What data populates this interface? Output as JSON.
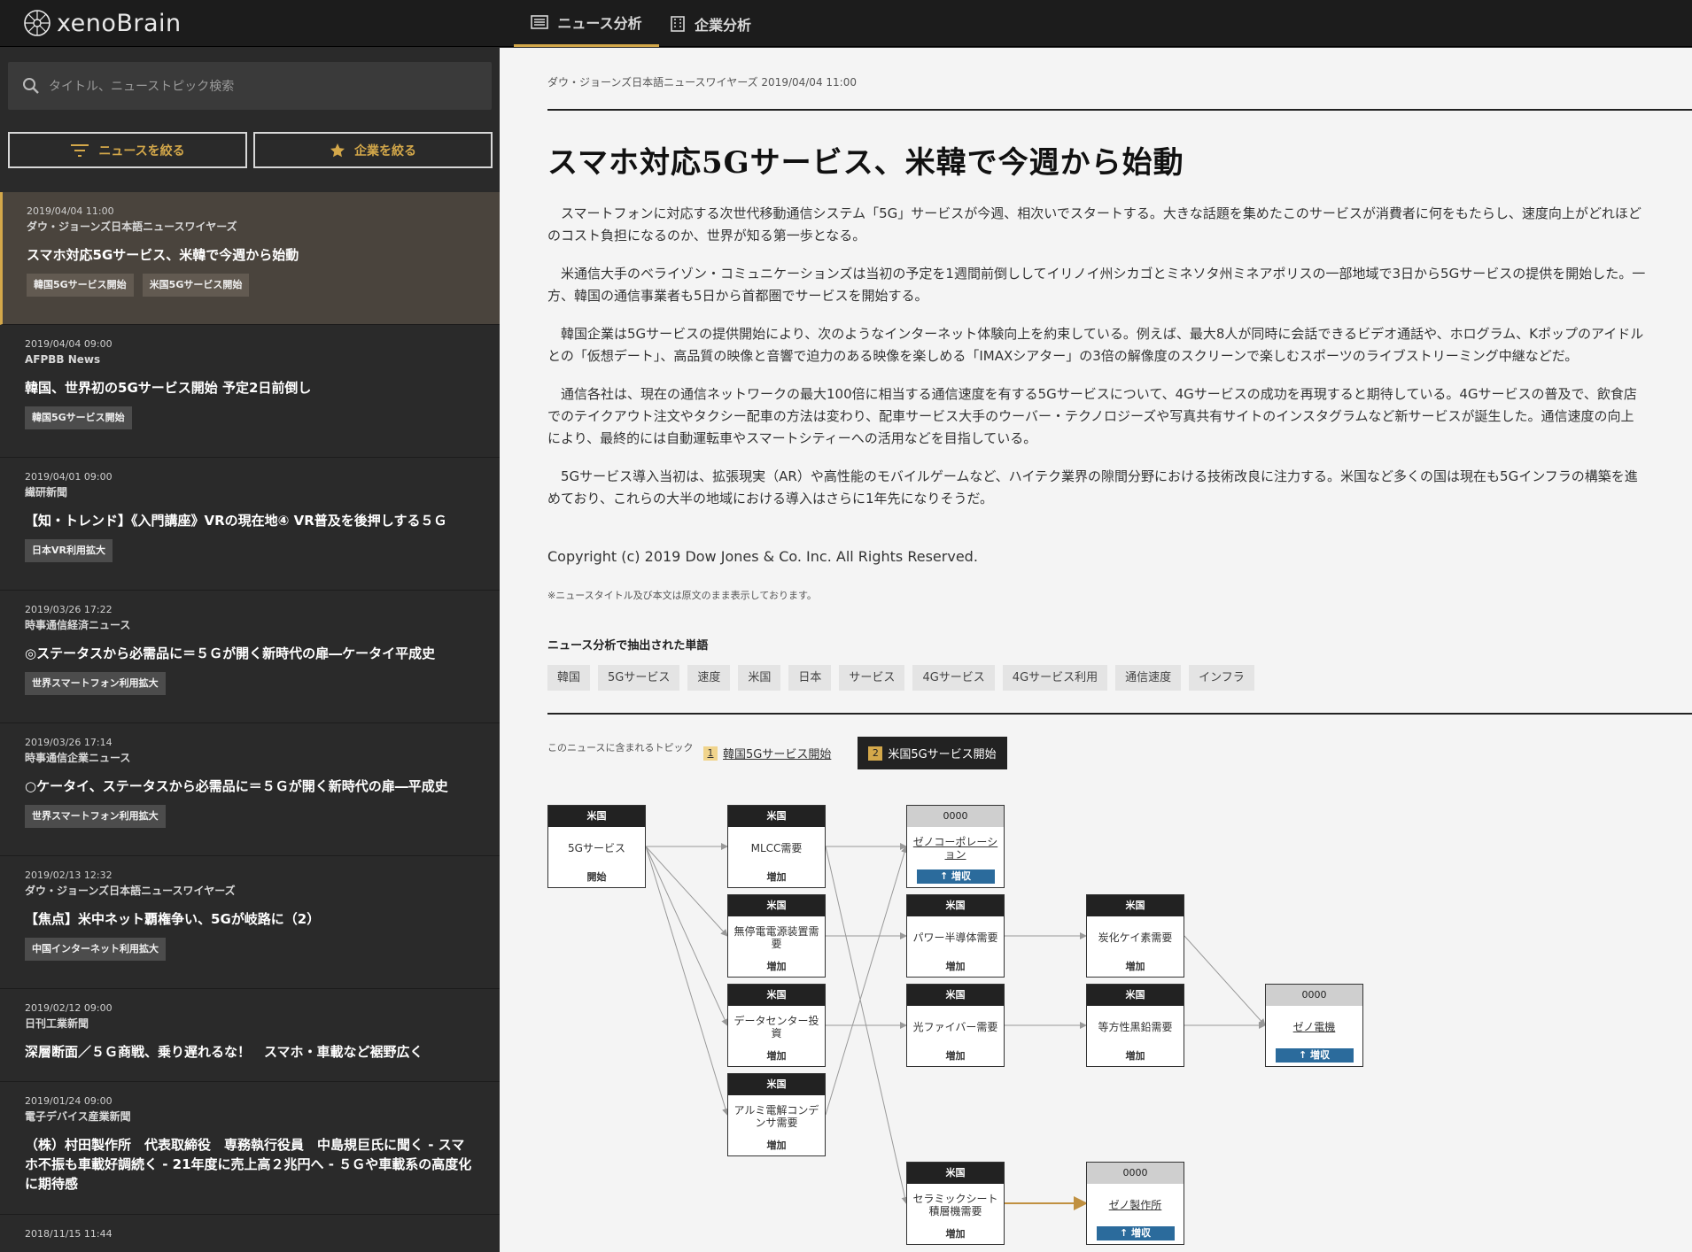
{
  "app": {
    "logo_text": "xenoBrain"
  },
  "nav": {
    "tabs": [
      {
        "label": "ニュース分析",
        "active": true
      },
      {
        "label": "企業分析",
        "active": false
      }
    ]
  },
  "sidebar": {
    "search_placeholder": "タイトル、ニューストピック検索",
    "filter_news": "ニュースを絞る",
    "filter_company": "企業を絞る",
    "news": [
      {
        "date": "2019/04/04 11:00",
        "source": "ダウ・ジョーンズ日本語ニュースワイヤーズ",
        "title": "スマホ対応5Gサービス、米韓で今週から始動",
        "tags": [
          "韓国5Gサービス開始",
          "米国5Gサービス開始"
        ],
        "selected": true
      },
      {
        "date": "2019/04/04 09:00",
        "source": "AFPBB News",
        "title": "韓国、世界初の5Gサービス開始 予定2日前倒し",
        "tags": [
          "韓国5Gサービス開始"
        ]
      },
      {
        "date": "2019/04/01 09:00",
        "source": "繊研新聞",
        "title": "【知・トレンド】《入門講座》VRの現在地④ VR普及を後押しする５Ｇ",
        "tags": [
          "日本VR利用拡大"
        ]
      },
      {
        "date": "2019/03/26 17:22",
        "source": "時事通信経済ニュース",
        "title": "◎ステータスから必需品に＝５Ｇが開く新時代の扉―ケータイ平成史",
        "tags": [
          "世界スマートフォン利用拡大"
        ]
      },
      {
        "date": "2019/03/26 17:14",
        "source": "時事通信企業ニュース",
        "title": "○ケータイ、ステータスから必需品に＝５Ｇが開く新時代の扉―平成史",
        "tags": [
          "世界スマートフォン利用拡大"
        ]
      },
      {
        "date": "2019/02/13 12:32",
        "source": "ダウ・ジョーンズ日本語ニュースワイヤーズ",
        "title": "【焦点】米中ネット覇権争い、5Gが岐路に（2）",
        "tags": [
          "中国インターネット利用拡大"
        ]
      },
      {
        "date": "2019/02/12 09:00",
        "source": "日刊工業新聞",
        "title": "深層断面／５Ｇ商戦、乗り遅れるな！　スマホ・車載など裾野広く",
        "tags": []
      },
      {
        "date": "2019/01/24 09:00",
        "source": "電子デバイス産業新聞",
        "title": "（株）村田製作所　代表取締役　専務執行役員　中島規巨氏に聞く - スマホ不振も車載好調続く - 21年度に売上高２兆円へ - ５Ｇや車載系の高度化に期待感",
        "tags": []
      },
      {
        "date": "2018/11/15 11:44",
        "source": "",
        "title": "",
        "tags": []
      }
    ]
  },
  "article": {
    "meta": "ダウ・ジョーンズ日本語ニュースワイヤーズ 2019/04/04 11:00",
    "title": "スマホ対応5Gサービス、米韓で今週から始動",
    "paragraphs": [
      "スマートフォンに対応する次世代移動通信システム「5G」サービスが今週、相次いでスタートする。大きな話題を集めたこのサービスが消費者に何をもたらし、速度向上がどれほどのコスト負担になるのか、世界が知る第一歩となる。",
      "米通信大手のベライゾン・コミュニケーションズは当初の予定を1週間前倒ししてイリノイ州シカゴとミネソタ州ミネアポリスの一部地域で3日から5Gサービスの提供を開始した。一方、韓国の通信事業者も5日から首都圏でサービスを開始する。",
      "韓国企業は5Gサービスの提供開始により、次のようなインターネット体験向上を約束している。例えば、最大8人が同時に会話できるビデオ通話や、ホログラム、Kポップのアイドルとの「仮想デート」、高品質の映像と音響で迫力のある映像を楽しめる「IMAXシアター」の3倍の解像度のスクリーンで楽しむスポーツのライブストリーミング中継などだ。",
      "通信各社は、現在の通信ネットワークの最大100倍に相当する通信速度を有する5Gサービスについて、4Gサービスの成功を再現すると期待している。4Gサービスの普及で、飲食店でのテイクアウト注文やタクシー配車の方法は変わり、配車サービス大手のウーバー・テクノロジーズや写真共有サイトのインスタグラムなど新サービスが誕生した。通信速度の向上により、最終的には自動運転車やスマートシティーへの活用などを目指している。",
      "5Gサービス導入当初は、拡張現実（AR）や高性能のモバイルゲームなど、ハイテク業界の隙間分野における技術改良に注力する。米国など多くの国は現在も5Gインフラの構築を進めており、これらの大半の地域における導入はさらに1年先になりそうだ。"
    ],
    "copyright": "Copyright (c) 2019 Dow Jones & Co. Inc. All Rights Reserved.",
    "note": "※ニュースタイトル及び本文は原文のまま表示しております。",
    "words_heading": "ニュース分析で抽出された単語",
    "words": [
      "韓国",
      "5Gサービス",
      "速度",
      "米国",
      "日本",
      "サービス",
      "4Gサービス",
      "4Gサービス利用",
      "通信速度",
      "インフラ"
    ]
  },
  "topics": {
    "label": "このニュースに含まれるトピック",
    "items": [
      {
        "num": "1",
        "label": "韓国5Gサービス開始"
      },
      {
        "num": "2",
        "label": "米国5Gサービス開始",
        "active": true
      }
    ]
  },
  "graph": {
    "nodes": [
      {
        "id": "n0",
        "header": "米国",
        "label": "5Gサービス",
        "footer": "開始"
      },
      {
        "id": "n1",
        "header": "米国",
        "label": "MLCC需要",
        "footer": "増加"
      },
      {
        "id": "n2",
        "header": "米国",
        "label": "無停電電源装置需要",
        "footer": "増加"
      },
      {
        "id": "n3",
        "header": "米国",
        "label": "データセンター投資",
        "footer": "増加"
      },
      {
        "id": "n4",
        "header": "米国",
        "label": "アルミ電解コンデンサ需要",
        "footer": "増加"
      },
      {
        "id": "n5",
        "header": "0000",
        "label": "ゼノコーポレーション",
        "badge": "増収",
        "company": true
      },
      {
        "id": "n6",
        "header": "米国",
        "label": "パワー半導体需要",
        "footer": "増加"
      },
      {
        "id": "n7",
        "header": "米国",
        "label": "光ファイバー需要",
        "footer": "増加"
      },
      {
        "id": "n8",
        "header": "米国",
        "label": "セラミックシート積層機需要",
        "footer": "増加"
      },
      {
        "id": "n9",
        "header": "米国",
        "label": "炭化ケイ素需要",
        "footer": "増加"
      },
      {
        "id": "n10",
        "header": "米国",
        "label": "等方性黒鉛需要",
        "footer": "増加"
      },
      {
        "id": "n11",
        "header": "0000",
        "label": "ゼノ製作所",
        "badge": "増収",
        "company": true
      },
      {
        "id": "n12",
        "header": "0000",
        "label": "ゼノ電機",
        "badge": "増収",
        "company": true
      }
    ]
  },
  "colors": {
    "accent": "#d4a84a",
    "badge": "#2b6b9c",
    "dark": "#1c1c1c"
  }
}
